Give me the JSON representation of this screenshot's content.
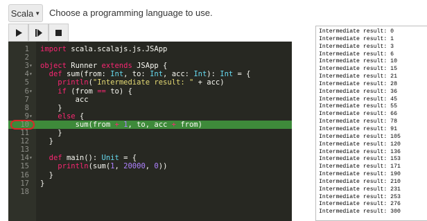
{
  "header": {
    "language_button_label": "Scala",
    "hint": "Choose a programming language to use."
  },
  "toolbar": {
    "run_icon": "play-icon",
    "step_icon": "step-icon",
    "stop_icon": "stop-icon"
  },
  "editor": {
    "line_numbers": [
      "1",
      "2",
      "3",
      "4",
      "5",
      "6",
      "7",
      "8",
      "9",
      "10",
      "11",
      "12",
      "13",
      "14",
      "15",
      "16",
      "17",
      "18"
    ],
    "active_line": 10,
    "breakpoint_line": 5,
    "lines": [
      [
        {
          "c": "k",
          "t": "import"
        },
        {
          "c": "",
          "t": " scala.scalajs.js.JSApp"
        }
      ],
      [],
      [
        {
          "c": "k",
          "t": "object"
        },
        {
          "c": "",
          "t": " Runner "
        },
        {
          "c": "k",
          "t": "extends"
        },
        {
          "c": "",
          "t": " JSApp {"
        }
      ],
      [
        {
          "c": "",
          "t": "  "
        },
        {
          "c": "k",
          "t": "def"
        },
        {
          "c": "",
          "t": " sum(from: "
        },
        {
          "c": "t",
          "t": "Int"
        },
        {
          "c": "",
          "t": ", to: "
        },
        {
          "c": "t",
          "t": "Int"
        },
        {
          "c": "",
          "t": ", acc: "
        },
        {
          "c": "t",
          "t": "Int"
        },
        {
          "c": "",
          "t": "): "
        },
        {
          "c": "t",
          "t": "Int"
        },
        {
          "c": "",
          "t": " = {"
        }
      ],
      [
        {
          "c": "",
          "t": "    "
        },
        {
          "c": "k",
          "t": "println"
        },
        {
          "c": "",
          "t": "("
        },
        {
          "c": "s",
          "t": "\"Intermediate result: \""
        },
        {
          "c": "",
          "t": " + acc)"
        }
      ],
      [
        {
          "c": "",
          "t": "    "
        },
        {
          "c": "k",
          "t": "if"
        },
        {
          "c": "",
          "t": " (from "
        },
        {
          "c": "k",
          "t": "=="
        },
        {
          "c": "",
          "t": " to) {"
        }
      ],
      [
        {
          "c": "",
          "t": "        acc"
        }
      ],
      [
        {
          "c": "",
          "t": "    }"
        }
      ],
      [
        {
          "c": "",
          "t": "    "
        },
        {
          "c": "k",
          "t": "else"
        },
        {
          "c": "",
          "t": " {"
        }
      ],
      [
        {
          "c": "",
          "t": "        sum(from "
        },
        {
          "c": "k",
          "t": "+"
        },
        {
          "c": "",
          "t": " "
        },
        {
          "c": "n",
          "t": "1"
        },
        {
          "c": "",
          "t": ", to, acc "
        },
        {
          "c": "k",
          "t": "+"
        },
        {
          "c": "",
          "t": " from)"
        }
      ],
      [
        {
          "c": "",
          "t": "    }"
        }
      ],
      [
        {
          "c": "",
          "t": "  }"
        }
      ],
      [],
      [
        {
          "c": "",
          "t": "  "
        },
        {
          "c": "k",
          "t": "def"
        },
        {
          "c": "",
          "t": " main(): "
        },
        {
          "c": "t",
          "t": "Unit"
        },
        {
          "c": "",
          "t": " = {"
        }
      ],
      [
        {
          "c": "",
          "t": "    "
        },
        {
          "c": "k",
          "t": "println"
        },
        {
          "c": "",
          "t": "(sum("
        },
        {
          "c": "n",
          "t": "1"
        },
        {
          "c": "",
          "t": ", "
        },
        {
          "c": "n",
          "t": "20000"
        },
        {
          "c": "",
          "t": ", "
        },
        {
          "c": "n",
          "t": "0"
        },
        {
          "c": "",
          "t": "))"
        }
      ],
      [
        {
          "c": "",
          "t": "  }"
        }
      ],
      [
        {
          "c": "",
          "t": "}"
        }
      ],
      []
    ]
  },
  "console": {
    "lines": [
      "Intermediate result: 0",
      "Intermediate result: 1",
      "Intermediate result: 3",
      "Intermediate result: 6",
      "Intermediate result: 10",
      "Intermediate result: 15",
      "Intermediate result: 21",
      "Intermediate result: 28",
      "Intermediate result: 36",
      "Intermediate result: 45",
      "Intermediate result: 55",
      "Intermediate result: 66",
      "Intermediate result: 78",
      "Intermediate result: 91",
      "Intermediate result: 105",
      "Intermediate result: 120",
      "Intermediate result: 136",
      "Intermediate result: 153",
      "Intermediate result: 171",
      "Intermediate result: 190",
      "Intermediate result: 210",
      "Intermediate result: 231",
      "Intermediate result: 253",
      "Intermediate result: 276",
      "Intermediate result: 300"
    ]
  },
  "colors": {
    "editor_bg": "#272822",
    "active_line": "#3e8a3a",
    "breakpoint": "#d9262a",
    "keyword": "#f92672",
    "type": "#66d9ef",
    "string": "#e6db74",
    "number": "#ae81ff"
  }
}
